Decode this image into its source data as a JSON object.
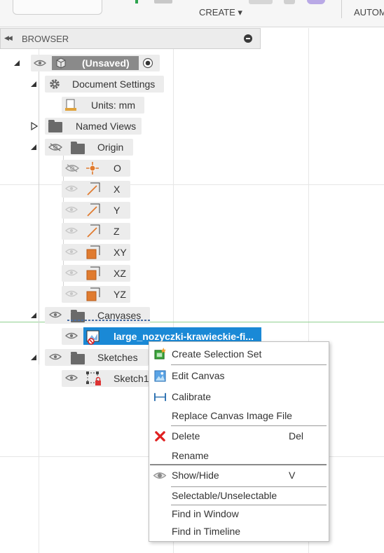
{
  "toolbar": {
    "create_label": "CREATE ▾",
    "automate_label": "AUTOM"
  },
  "browser": {
    "title": "BROWSER",
    "root": {
      "label": "(Unsaved)"
    },
    "document_settings": {
      "label": "Document Settings",
      "units_label": "Units: mm"
    },
    "named_views": {
      "label": "Named Views"
    },
    "origin": {
      "label": "Origin",
      "items": [
        {
          "label": "O"
        },
        {
          "label": "X"
        },
        {
          "label": "Y"
        },
        {
          "label": "Z"
        },
        {
          "label": "XY"
        },
        {
          "label": "XZ"
        },
        {
          "label": "YZ"
        }
      ]
    },
    "canvases": {
      "label": "Canvases",
      "item_label": "large_nozyczki-krawieckie-fi..."
    },
    "sketches": {
      "label": "Sketches",
      "item_label": "Sketch1"
    }
  },
  "context_menu": {
    "create_selection_set": "Create Selection Set",
    "edit_canvas": "Edit Canvas",
    "calibrate": "Calibrate",
    "replace_canvas_image_file": "Replace Canvas Image File",
    "delete": "Delete",
    "delete_shortcut": "Del",
    "rename": "Rename",
    "show_hide": "Show/Hide",
    "show_hide_shortcut": "V",
    "selectable_unselectable": "Selectable/Unselectable",
    "find_in_window": "Find in Window",
    "find_in_timeline": "Find in Timeline"
  },
  "colors": {
    "selection": "#1a89d6",
    "origin_accent": "#e07b2f",
    "delete_red": "#e02020"
  }
}
